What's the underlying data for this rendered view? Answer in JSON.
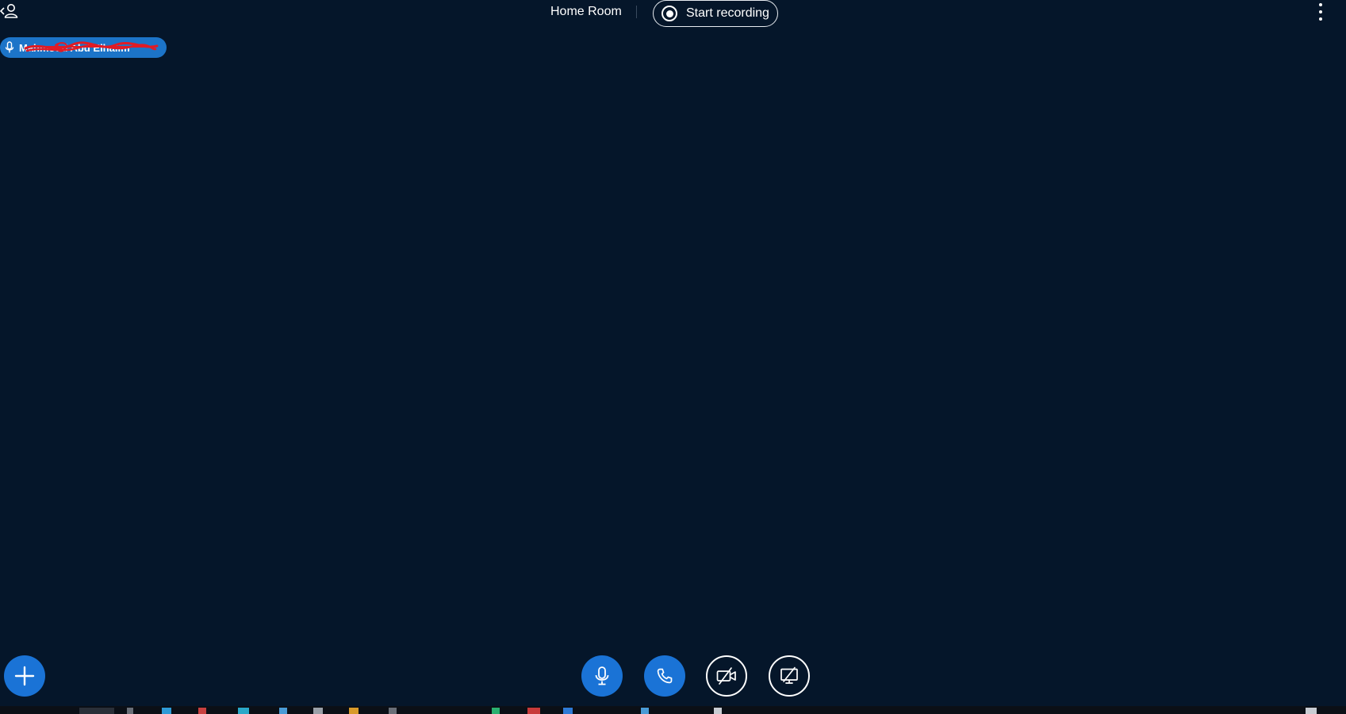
{
  "header": {
    "room_title": "Home Room",
    "record_label": "Start recording"
  },
  "participant": {
    "name": "Mahmoud Abd Elhalim",
    "name_redacted": true,
    "mic_icon": "mic-icon"
  },
  "controls": {
    "add": "plus-icon",
    "mic": "mic-icon",
    "call": "phone-icon",
    "video": "video-off-icon",
    "share": "screen-share-off-icon"
  },
  "colors": {
    "background": "#05162a",
    "accent": "#1a73d6",
    "pill": "#1c74c8",
    "redaction": "#e01b24"
  }
}
